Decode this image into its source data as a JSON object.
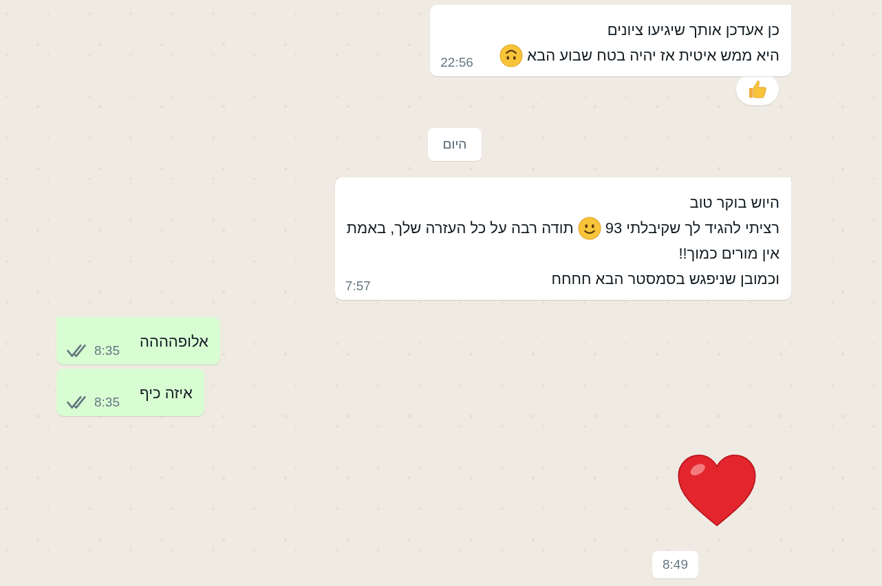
{
  "items": [
    {
      "kind": "message",
      "outgoing": false,
      "lines": [
        [
          {
            "kind": "text",
            "text": "כן אעדכן אותך שיגיעו ציונים"
          }
        ],
        [
          {
            "kind": "text",
            "text": "היא ממש איטית אז יהיה בטח שבוע הבא"
          },
          {
            "kind": "emoji-upside-down"
          }
        ]
      ],
      "time": "22:56",
      "reaction": {
        "kind": "thumbs-up"
      }
    },
    {
      "kind": "date-chip",
      "text": "היום"
    },
    {
      "kind": "message",
      "outgoing": false,
      "lines": [
        [
          {
            "kind": "text",
            "text": "היוש בוקר טוב"
          }
        ],
        [
          {
            "kind": "text",
            "text": "רציתי להגיד לך שקיבלתי 93"
          },
          {
            "kind": "emoji-smile"
          },
          {
            "kind": "text",
            "text": "תודה רבה על כל העזרה שלך, באמת"
          }
        ],
        [
          {
            "kind": "text",
            "text": "אין מורים כמוך!!"
          }
        ],
        [
          {
            "kind": "text",
            "text": "וכמובן שניפגש בסמסטר הבא חחחח"
          }
        ]
      ],
      "time": "7:57"
    },
    {
      "kind": "message",
      "outgoing": true,
      "lines": [
        [
          {
            "kind": "text",
            "text": "אלופהההה"
          }
        ]
      ],
      "time": "8:35",
      "read": false
    },
    {
      "kind": "message",
      "outgoing": true,
      "lines": [
        [
          {
            "kind": "text",
            "text": "איזה כיף"
          }
        ]
      ],
      "time": "8:35",
      "read": false
    },
    {
      "kind": "big-heart",
      "time": "8:49"
    }
  ]
}
